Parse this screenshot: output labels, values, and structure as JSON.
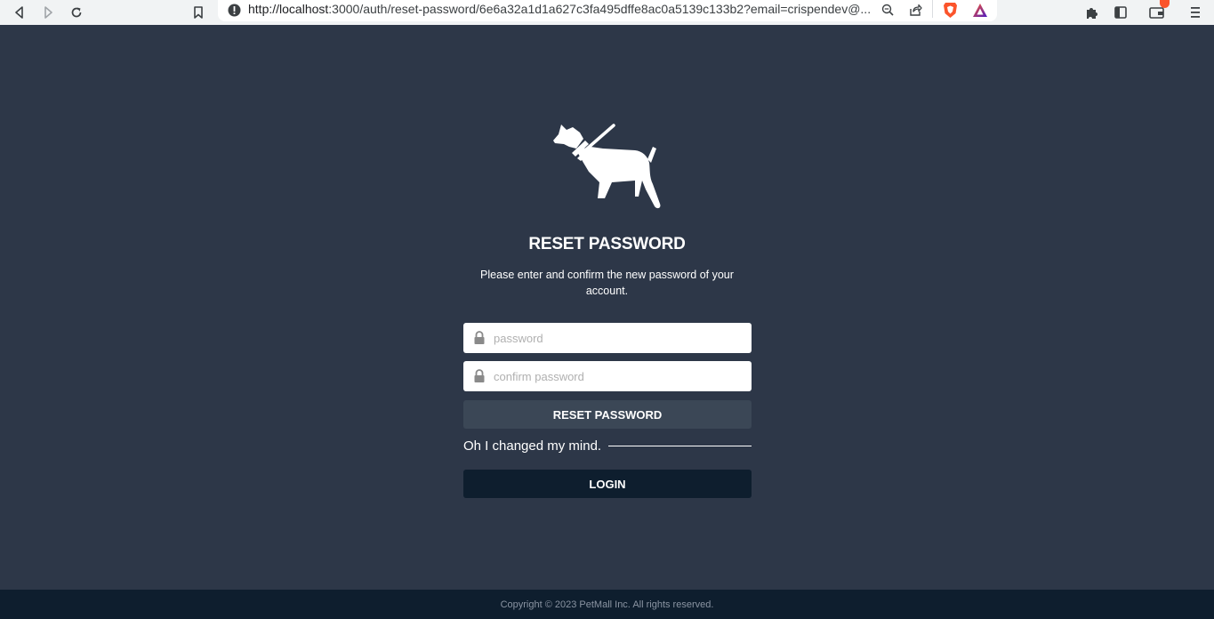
{
  "browser": {
    "url_host": "http://localhost",
    "url_rest": ":3000/auth/reset-password/6e6a32a1d1a627c3fa495dffe8ac0a5139c133b2?email=crispendev@...",
    "icons": [
      "back-icon",
      "forward-icon",
      "reload-icon",
      "bookmark-icon",
      "site-info-icon",
      "zoom-icon",
      "share-icon",
      "brave-shield-icon",
      "brave-rewards-icon",
      "extensions-icon",
      "sidebar-icon",
      "wallet-icon",
      "menu-icon"
    ]
  },
  "page": {
    "title": "RESET PASSWORD",
    "subtitle": "Please enter and confirm the new password of your account.",
    "password_placeholder": "password",
    "confirm_placeholder": "confirm password",
    "reset_button": "RESET PASSWORD",
    "divider_text": "Oh I changed my mind.",
    "login_button": "LOGIN"
  },
  "footer": {
    "copyright": "Copyright © 2023 PetMall Inc. All rights reserved."
  },
  "colors": {
    "background": "#2d3748",
    "reset_button": "#3b4756",
    "login_button": "#0e1e2e",
    "footer": "#0e1e2e",
    "brave_badge": "#fb542b"
  }
}
